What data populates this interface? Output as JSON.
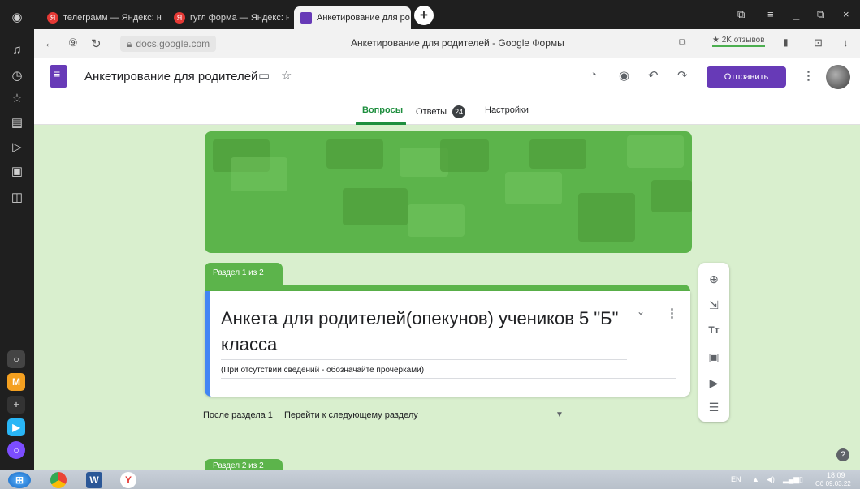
{
  "browser": {
    "tabs": [
      {
        "label": "телеграмм — Яндекс: нас"
      },
      {
        "label": "гугл форма — Яндекс: нас"
      },
      {
        "label": "Анкетирование для ро"
      }
    ],
    "url": "docs.google.com",
    "page_title": "Анкетирование для родителей - Google Формы",
    "reviews": "★ 2K отзывов"
  },
  "form_header": {
    "title": "Анкетирование для родителей",
    "send_label": "Отправить",
    "tabs": {
      "questions": "Вопросы",
      "answers": "Ответы",
      "answers_count": "24",
      "settings": "Настройки"
    }
  },
  "section": {
    "label": "Раздел 1 из 2",
    "title": "Анкета для родителей(опекунов) учеников 5 \"Б\" класса",
    "description": "(При отсутствии сведений - обозначайте прочерками)",
    "after_label": "После раздела 1",
    "after_value": "Перейти к следующему разделу",
    "next_label": "Раздел 2 из 2"
  },
  "taskbar": {
    "lang": "EN",
    "time": "18:09",
    "date": "Сб 09.03.22"
  },
  "colors": {
    "accent": "#673ab7",
    "theme_green": "#5cb44b",
    "background": "#d9efce"
  }
}
